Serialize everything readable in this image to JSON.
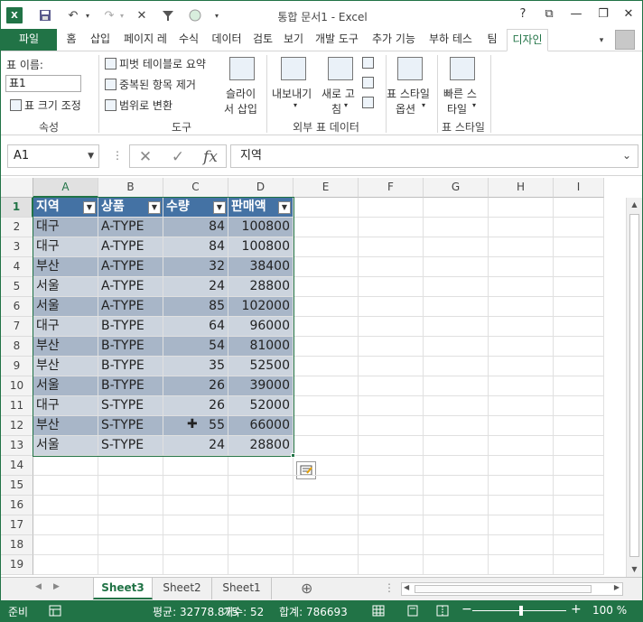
{
  "titlebar": {
    "title": "통합 문서1 - Excel",
    "help": "?",
    "ribbon_display": "⧉",
    "minimize": "—",
    "restore": "❐",
    "close": "✕"
  },
  "tabs": [
    "파일",
    "홈",
    "삽입",
    "페이지 레",
    "수식",
    "데이터",
    "검토",
    "보기",
    "개발 도구",
    "추가 기능",
    "부하 테스",
    "팀",
    "디자인"
  ],
  "ribbon": {
    "props_label": "표 이름:",
    "table_name": "표1",
    "resize": "표 크기 조정",
    "props_group": "속성",
    "pivot": "피벗 테이블로 요약",
    "remove_dup": "중복된 항목 제거",
    "convert_range": "범위로 변환",
    "slicer_line1": "슬라이",
    "slicer_line2": "서 삽입",
    "tools_group": "도구",
    "export_line1": "내보내기",
    "refresh_line1": "새로 고",
    "refresh_line2": "침",
    "external_group": "외부 표 데이터",
    "style_options_line1": "표 스타일",
    "style_options_line2": "옵션",
    "quick_styles_line1": "빠른 스",
    "quick_styles_line2": "타일",
    "styles_group": "표 스타일"
  },
  "formula_bar": {
    "name_box": "A1",
    "formula": "지역",
    "cancel": "✕",
    "enter": "✓",
    "fx": "fx"
  },
  "columns": [
    "A",
    "B",
    "C",
    "D",
    "E",
    "F",
    "G",
    "H",
    "I"
  ],
  "rows": [
    "1",
    "2",
    "3",
    "4",
    "5",
    "6",
    "7",
    "8",
    "9",
    "10",
    "11",
    "12",
    "13",
    "14",
    "15",
    "16",
    "17",
    "18",
    "19"
  ],
  "table": {
    "headers": [
      "지역",
      "상품",
      "수량",
      "판매액"
    ],
    "rows": [
      [
        "대구",
        "A-TYPE",
        "84",
        "100800"
      ],
      [
        "대구",
        "A-TYPE",
        "84",
        "100800"
      ],
      [
        "부산",
        "A-TYPE",
        "32",
        "38400"
      ],
      [
        "서울",
        "A-TYPE",
        "24",
        "28800"
      ],
      [
        "서울",
        "A-TYPE",
        "85",
        "102000"
      ],
      [
        "대구",
        "B-TYPE",
        "64",
        "96000"
      ],
      [
        "부산",
        "B-TYPE",
        "54",
        "81000"
      ],
      [
        "부산",
        "B-TYPE",
        "35",
        "52500"
      ],
      [
        "서울",
        "B-TYPE",
        "26",
        "39000"
      ],
      [
        "대구",
        "S-TYPE",
        "26",
        "52000"
      ],
      [
        "부산",
        "S-TYPE",
        "55",
        "66000"
      ],
      [
        "서울",
        "S-TYPE",
        "24",
        "28800"
      ]
    ]
  },
  "sheets": [
    "Sheet3",
    "Sheet2",
    "Sheet1"
  ],
  "status": {
    "ready": "준비",
    "average": "평균: 32778.875",
    "count": "개수: 52",
    "sum": "합계: 786693",
    "zoom": "100 %"
  },
  "colors": {
    "accent": "#217346",
    "table_header": "#4472a4",
    "band_dark": "#a8b6c8",
    "band_light": "#ccd4de"
  }
}
